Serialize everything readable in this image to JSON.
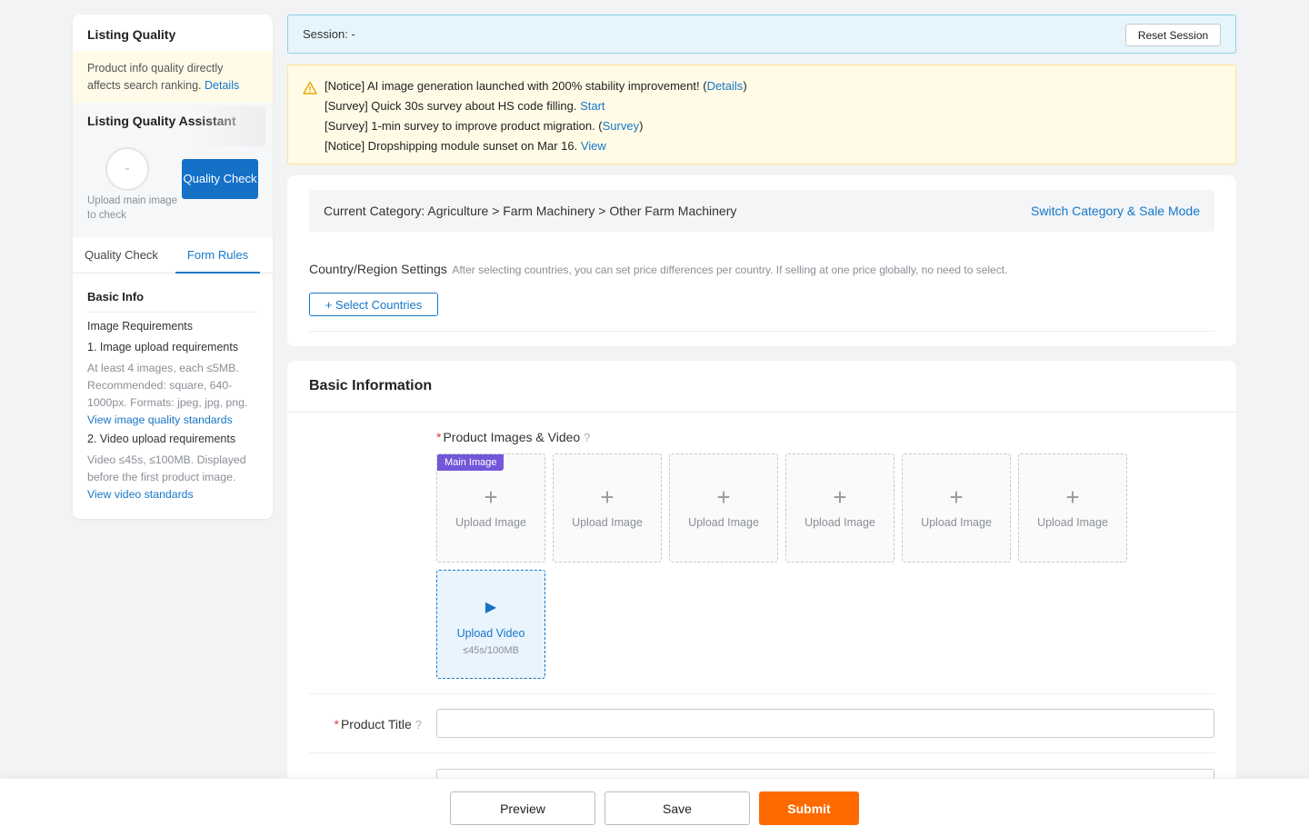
{
  "sidebar": {
    "title": "Listing Quality",
    "notice_text": "Product info quality directly affects search ranking.",
    "notice_link": "Details",
    "assistant_title": "Listing Quality Assistant",
    "score": "-",
    "upload_hint": "Upload main image to check",
    "quality_check_button": "Quality Check",
    "tabs": [
      {
        "label": "Quality Check",
        "active": false
      },
      {
        "label": "Form Rules",
        "active": true
      }
    ],
    "rules": {
      "section_title": "Basic Info",
      "image_requirements_title": "Image Requirements",
      "item1_title": "1. Image upload requirements",
      "item1_text": "At least 4 images, each ≤5MB. Recommended: square, 640-1000px. Formats: jpeg, jpg, png.",
      "item1_link": "View image quality standards",
      "item2_title": "2. Video upload requirements",
      "item2_text": "Video ≤45s, ≤100MB. Displayed before the first product image.",
      "item2_link": "View video standards"
    }
  },
  "session": {
    "label": "Session: -",
    "reset_button": "Reset Session"
  },
  "notices": [
    {
      "text": "[Notice] AI image generation launched with 200% stability improvement! (",
      "link": "Details",
      "suffix": ")"
    },
    {
      "text": "[Survey] Quick 30s survey about HS code filling. ",
      "link": "Start",
      "suffix": ""
    },
    {
      "text": "[Survey] 1-min survey to improve product migration. (",
      "link": "Survey",
      "suffix": ")"
    },
    {
      "text": "[Notice] Dropshipping module sunset on Mar 16. ",
      "link": "View",
      "suffix": ""
    }
  ],
  "category": {
    "current": "Current Category: Agriculture > Farm Machinery > Other Farm Machinery",
    "switch_link": "Switch Category & Sale Mode"
  },
  "country": {
    "title": "Country/Region Settings",
    "hint": "After selecting countries, you can set price differences per country. If selling at one price globally, no need to select.",
    "select_button": "+ Select Countries"
  },
  "basic_info": {
    "title": "Basic Information",
    "images_label": "Product Images & Video",
    "help_icon": "?",
    "main_image_tag": "Main Image",
    "upload_image_label": "Upload Image",
    "image_slots": 6,
    "upload_video_label": "Upload Video",
    "video_limit": "≤45s/100MB",
    "product_title_label": "Product Title",
    "product_title_value": ""
  },
  "footer": {
    "preview": "Preview",
    "save": "Save",
    "submit": "Submit"
  },
  "colors": {
    "accent": "#1677c9",
    "primary_button": "#1570c8",
    "submit": "#ff6a00",
    "main_tag": "#7356d9",
    "notice_bg": "#fffbe6",
    "session_bg": "#e6f5fc"
  }
}
